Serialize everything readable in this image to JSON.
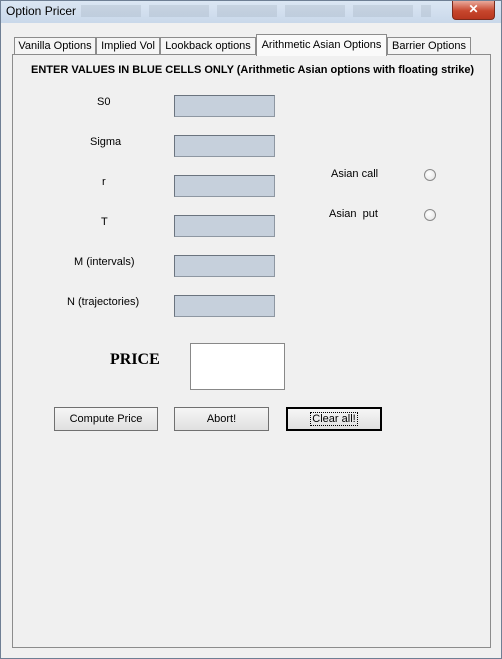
{
  "window": {
    "title": "Option Pricer",
    "close_glyph": "✕"
  },
  "tabs": [
    {
      "label": "Vanilla Options"
    },
    {
      "label": "Implied Vol"
    },
    {
      "label": "Lookback options"
    },
    {
      "label": "Arithmetic Asian Options",
      "active": true
    },
    {
      "label": "Barrier Options"
    }
  ],
  "instructions": "ENTER VALUES IN BLUE CELLS ONLY (Arithmetic Asian options with floating strike)",
  "fields": [
    {
      "label": "S0",
      "value": ""
    },
    {
      "label": "Sigma",
      "value": ""
    },
    {
      "label": "r",
      "value": ""
    },
    {
      "label": "T",
      "value": ""
    },
    {
      "label": "M (intervals)",
      "value": ""
    },
    {
      "label": "N (trajectories)",
      "value": ""
    }
  ],
  "options": [
    {
      "label": "Asian call",
      "selected": false
    },
    {
      "label": "Asian  put",
      "selected": false
    }
  ],
  "price": {
    "label": "PRICE",
    "value": ""
  },
  "buttons": {
    "compute": "Compute Price",
    "abort": "Abort!",
    "clear": "Clear all!"
  },
  "colors": {
    "input_blue": "#c6d0dc",
    "close_red": "#c7462d"
  }
}
